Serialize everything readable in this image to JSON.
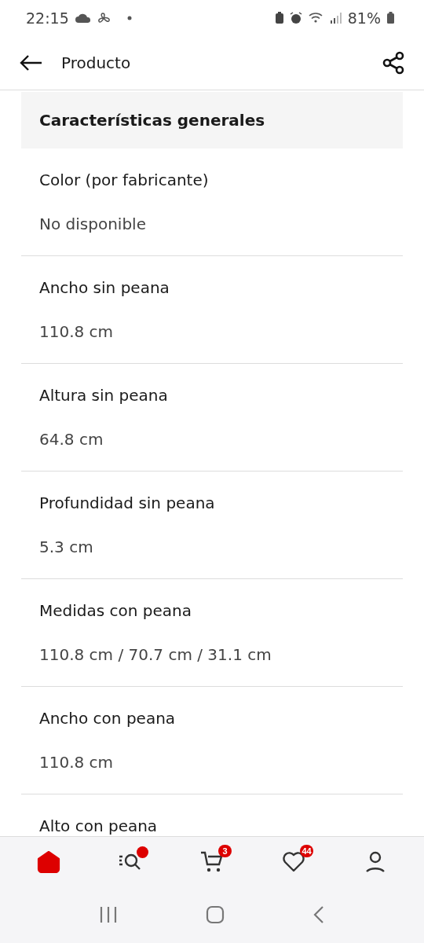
{
  "status_bar": {
    "time": "22:15",
    "battery": "81%"
  },
  "header": {
    "title": "Producto"
  },
  "section": {
    "title": "Características generales",
    "rows": [
      {
        "label": "Color (por fabricante)",
        "value": "No disponible"
      },
      {
        "label": "Ancho sin peana",
        "value": "110.8 cm"
      },
      {
        "label": "Altura sin peana",
        "value": "64.8 cm"
      },
      {
        "label": "Profundidad sin peana",
        "value": "5.3 cm"
      },
      {
        "label": "Medidas con peana",
        "value": "110.8 cm / 70.7 cm / 31.1 cm"
      },
      {
        "label": "Ancho con peana",
        "value": "110.8 cm"
      },
      {
        "label": "Alto con peana"
      }
    ]
  },
  "bottom_nav": [
    {
      "kind": "home",
      "selected": true
    },
    {
      "kind": "search",
      "selected": false,
      "dot": true
    },
    {
      "kind": "cart",
      "selected": false,
      "badge": "3"
    },
    {
      "kind": "wishlist",
      "selected": false,
      "badge": "44"
    },
    {
      "kind": "account",
      "selected": false
    }
  ]
}
